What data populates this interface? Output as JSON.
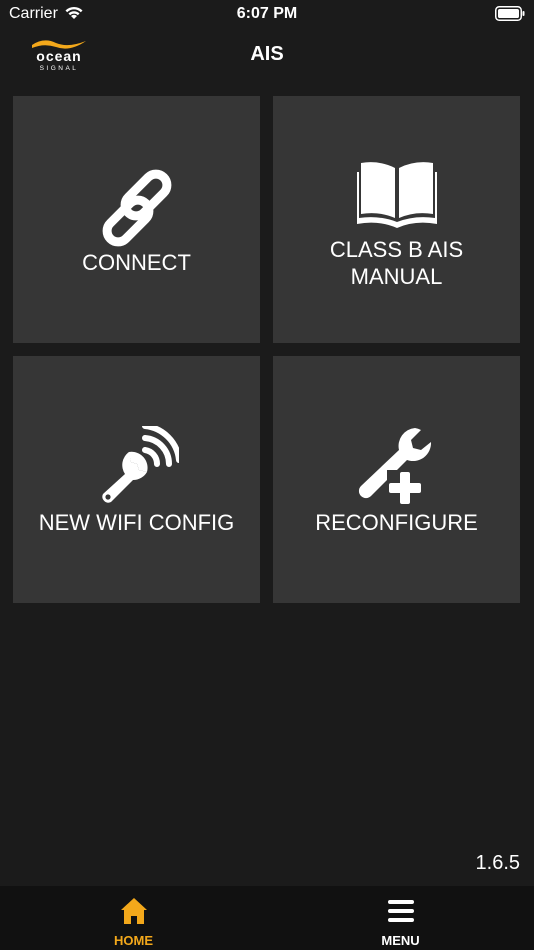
{
  "status_bar": {
    "carrier": "Carrier",
    "time": "6:07 PM"
  },
  "header": {
    "title": "AIS",
    "logo_top": "ocean",
    "logo_bottom": "SIGNAL"
  },
  "tiles": [
    {
      "label": "CONNECT",
      "icon": "link-icon"
    },
    {
      "label": "CLASS B AIS\nMANUAL",
      "icon": "book-icon"
    },
    {
      "label": "NEW WIFI CONFIG",
      "icon": "wifi-wrench-icon"
    },
    {
      "label": "RECONFIGURE",
      "icon": "wrench-plus-icon"
    }
  ],
  "version": "1.6.5",
  "tab_bar": {
    "home_label": "HOME",
    "menu_label": "MENU",
    "active": "home"
  },
  "colors": {
    "accent": "#f3a81b",
    "background": "#1b1b1b",
    "tile": "#363636",
    "tab_bar": "#111111"
  }
}
